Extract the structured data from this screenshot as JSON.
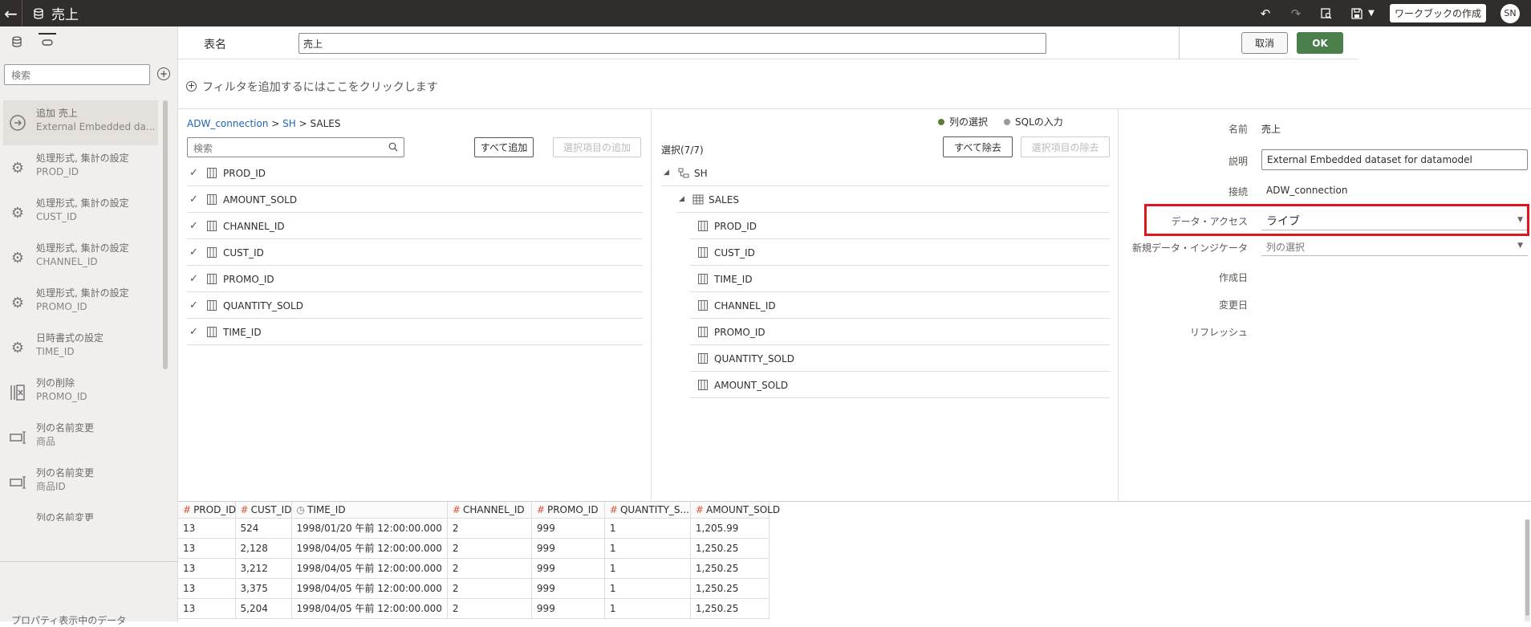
{
  "topbar": {
    "title": "売上",
    "workbook_button": "ワークブックの作成",
    "avatar": "SN"
  },
  "sidebar": {
    "search_placeholder": "検索",
    "steps": [
      {
        "l1": "追加 売上",
        "l2": "External Embedded da...",
        "icon": "arrow-right-circle-icon",
        "active": true
      },
      {
        "l1": "処理形式, 集計の設定",
        "l2": "PROD_ID",
        "icon": "gear-icon"
      },
      {
        "l1": "処理形式, 集計の設定",
        "l2": "CUST_ID",
        "icon": "gear-icon"
      },
      {
        "l1": "処理形式, 集計の設定",
        "l2": "CHANNEL_ID",
        "icon": "gear-icon"
      },
      {
        "l1": "処理形式, 集計の設定",
        "l2": "PROMO_ID",
        "icon": "gear-icon"
      },
      {
        "l1": "日時書式の設定",
        "l2": "TIME_ID",
        "icon": "gear-icon"
      },
      {
        "l1": "列の削除",
        "l2": "PROMO_ID",
        "icon": "delete-column-icon"
      },
      {
        "l1": "列の名前変更",
        "l2": "商品",
        "icon": "rename-icon"
      },
      {
        "l1": "列の名前変更",
        "l2": "商品ID",
        "icon": "rename-icon"
      },
      {
        "l1": "列の名前変更",
        "l2": "",
        "icon": "rename-icon"
      }
    ],
    "bottom_text": "プロパティ表示中のデータ"
  },
  "namebar": {
    "label": "表名",
    "value": "売上",
    "cancel": "取消",
    "ok": "OK"
  },
  "filter": {
    "text": "フィルタを追加するにはここをクリックします"
  },
  "left": {
    "breadcrumb": {
      "conn": "ADW_connection",
      "sep1": ">",
      "schema": "SH",
      "sep2": ">",
      "table": "SALES"
    },
    "search_placeholder": "検索",
    "add_all": "すべて追加",
    "add_selected": "選択項目の追加",
    "columns": [
      "PROD_ID",
      "AMOUNT_SOLD",
      "CHANNEL_ID",
      "CUST_ID",
      "PROMO_ID",
      "QUANTITY_SOLD",
      "TIME_ID"
    ]
  },
  "middle": {
    "radio_columns": "列の選択",
    "radio_sql": "SQLの入力",
    "selection_count": "選択(7/7)",
    "remove_all": "すべて除去",
    "remove_selected": "選択項目の除去",
    "schema": "SH",
    "table": "SALES",
    "columns": [
      "PROD_ID",
      "CUST_ID",
      "TIME_ID",
      "CHANNEL_ID",
      "PROMO_ID",
      "QUANTITY_SOLD",
      "AMOUNT_SOLD"
    ],
    "radio_selected_color": "#5a7d3c",
    "radio_unselected_color": "#999999"
  },
  "props": {
    "name_label": "名前",
    "name_value": "売上",
    "desc_label": "説明",
    "desc_value": "External Embedded dataset for datamodel",
    "conn_label": "接続",
    "conn_value": "ADW_connection",
    "access_label": "データ・アクセス",
    "access_value": "ライブ",
    "indicator_label": "新規データ・インジケータ",
    "indicator_placeholder": "列の選択",
    "created_label": "作成日",
    "modified_label": "変更日",
    "refresh_label": "リフレッシュ"
  },
  "grid": {
    "headers": [
      {
        "type": "#",
        "name": "PROD_ID"
      },
      {
        "type": "#",
        "name": "CUST_ID"
      },
      {
        "type": "clock",
        "name": "TIME_ID"
      },
      {
        "type": "#",
        "name": "CHANNEL_ID"
      },
      {
        "type": "#",
        "name": "PROMO_ID"
      },
      {
        "type": "#",
        "name": "QUANTITY_S..."
      },
      {
        "type": "#",
        "name": "AMOUNT_SOLD"
      }
    ],
    "rows": [
      [
        "13",
        "524",
        "1998/01/20 午前 12:00:00.000",
        "2",
        "999",
        "1",
        "1,205.99"
      ],
      [
        "13",
        "2,128",
        "1998/04/05 午前 12:00:00.000",
        "2",
        "999",
        "1",
        "1,250.25"
      ],
      [
        "13",
        "3,212",
        "1998/04/05 午前 12:00:00.000",
        "2",
        "999",
        "1",
        "1,250.25"
      ],
      [
        "13",
        "3,375",
        "1998/04/05 午前 12:00:00.000",
        "2",
        "999",
        "1",
        "1,250.25"
      ],
      [
        "13",
        "5,204",
        "1998/04/05 午前 12:00:00.000",
        "2",
        "999",
        "1",
        "1,250.25"
      ]
    ]
  },
  "colors": {
    "topbar_bg": "#312d2a",
    "ok_green": "#4a7e4a",
    "highlight_red": "#e0161f",
    "link_blue": "#1e64b4"
  }
}
